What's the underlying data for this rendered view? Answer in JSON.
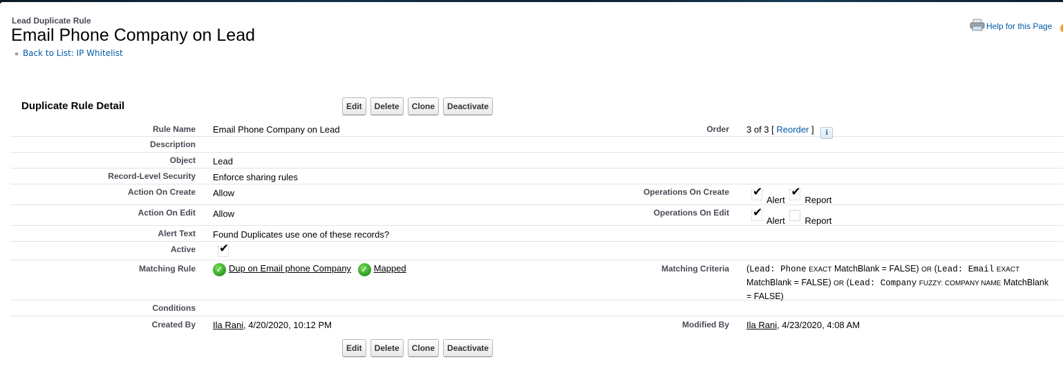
{
  "header": {
    "page_type": "Lead Duplicate Rule",
    "title": "Email Phone Company on Lead",
    "back_link_prefix": "«",
    "back_link": "Back to List: IP Whitelist",
    "help_link": "Help for this Page"
  },
  "section": {
    "title": "Duplicate Rule Detail"
  },
  "buttons": {
    "edit": "Edit",
    "delete": "Delete",
    "clone": "Clone",
    "deactivate": "Deactivate"
  },
  "fields": {
    "rule_name": {
      "label": "Rule Name",
      "value": "Email Phone Company on Lead"
    },
    "order": {
      "label": "Order",
      "value": "3 of 3",
      "open_bracket": "[",
      "reorder_link": "Reorder",
      "close_bracket": "]",
      "info_icon": "i"
    },
    "description": {
      "label": "Description",
      "value": ""
    },
    "object": {
      "label": "Object",
      "value": "Lead"
    },
    "record_level_security": {
      "label": "Record-Level Security",
      "value": "Enforce sharing rules"
    },
    "action_on_create": {
      "label": "Action On Create",
      "value": "Allow"
    },
    "operations_on_create": {
      "label": "Operations On Create",
      "alert_label": "Alert",
      "alert_checked": true,
      "report_label": "Report",
      "report_checked": true
    },
    "action_on_edit": {
      "label": "Action On Edit",
      "value": "Allow"
    },
    "operations_on_edit": {
      "label": "Operations On Edit",
      "alert_label": "Alert",
      "alert_checked": true,
      "report_label": "Report",
      "report_checked": false
    },
    "alert_text": {
      "label": "Alert Text",
      "value": "Found Duplicates use one of these records?"
    },
    "active": {
      "label": "Active",
      "checked": true
    },
    "matching_rule": {
      "label": "Matching Rule",
      "rule_link": "Dup on Email phone Company",
      "mapped_link": "Mapped"
    },
    "matching_criteria": {
      "label": "Matching Criteria",
      "parts": {
        "p1_open": "(",
        "p1_field": "Lead: Phone",
        "p1_type": "EXACT",
        "p1_rest": "MatchBlank = FALSE)",
        "or1": "OR",
        "p2_open": "(",
        "p2_field": "Lead: Email",
        "p2_type": "EXACT",
        "p2_rest": "MatchBlank = FALSE)",
        "or2": "OR",
        "p3_open": "(",
        "p3_field": "Lead: Company",
        "p3_type": "FUZZY: COMPANY NAME",
        "p3_rest": "MatchBlank = FALSE)"
      }
    },
    "conditions": {
      "label": "Conditions",
      "value": ""
    },
    "created_by": {
      "label": "Created By",
      "user": "Ila Rani",
      "date": ", 4/20/2020, 10:12 PM"
    },
    "modified_by": {
      "label": "Modified By",
      "user": "Ila Rani",
      "date": ", 4/23/2020, 4:08 AM"
    }
  },
  "colors": {
    "link_blue": "#015ba7",
    "label_gray": "#4a4a56",
    "row_divider": "#e3e3e7"
  }
}
